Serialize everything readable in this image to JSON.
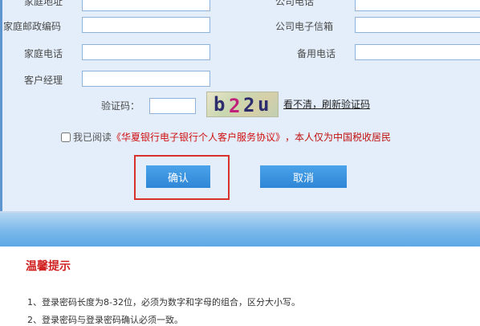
{
  "form": {
    "labels": {
      "home_address": "家庭地址",
      "company_phone": "公司电话",
      "home_postcode": "家庭邮政编码",
      "company_email": "公司电子信箱",
      "home_phone": "家庭电话",
      "backup_phone": "备用电话",
      "account_manager": "客户经理",
      "captcha": "验证码："
    },
    "captcha_text": "b22u",
    "refresh_captcha": "看不清，刷新验证码",
    "agreement": {
      "prefix": "我已阅读",
      "link": "《华夏银行电子银行个人客户服务协议》",
      "suffix": "，本人仅为中国税收居民"
    },
    "confirm_button": "确认",
    "cancel_button": "取消"
  },
  "tips": {
    "title": "温馨提示",
    "items": [
      "1、登录密码长度为8-32位，必须为数字和字母的组合，区分大小写。",
      "2、登录密码与登录密码确认必须一致。"
    ]
  },
  "colors": {
    "panel_bg": "#e4eefa",
    "accent_blue": "#2f86d6",
    "warning_red": "#d01f1f",
    "highlight_red": "#d9322e"
  }
}
